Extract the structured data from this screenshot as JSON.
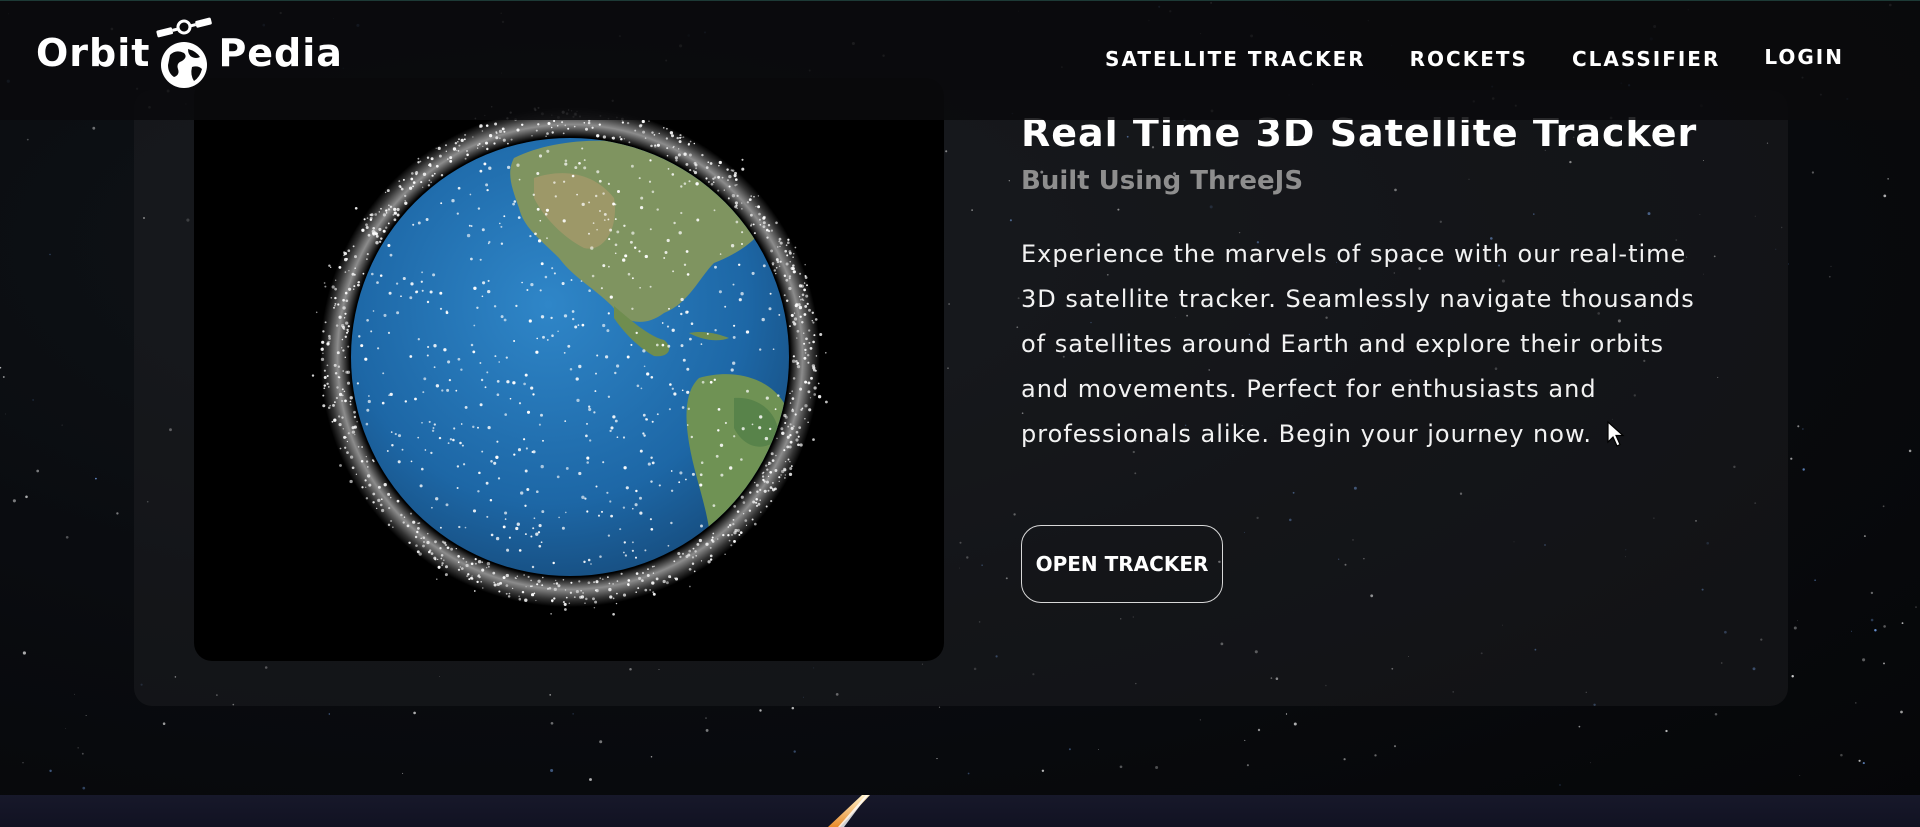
{
  "header": {
    "logo_left": "Orbit",
    "logo_right": "Pedia",
    "nav": [
      {
        "label": "SATELLITE TRACKER"
      },
      {
        "label": "ROCKETS"
      },
      {
        "label": "CLASSIFIER"
      },
      {
        "label": "LOGIN"
      }
    ]
  },
  "hero": {
    "title": "Real Time 3D Satellite Tracker",
    "subtitle": "Built Using ThreeJS",
    "description": "Experience the marvels of space with our real-time 3D satellite tracker. Seamlessly navigate thousands of satellites around Earth and explore their orbits and movements. Perfect for enthusiasts and professionals alike. Begin your journey now.",
    "cta_label": "OPEN TRACKER"
  },
  "colors": {
    "background": "#07090d",
    "ocean": "#1e6aa8",
    "land": "#6f8f4e",
    "subtitle": "#8e8e8e"
  }
}
